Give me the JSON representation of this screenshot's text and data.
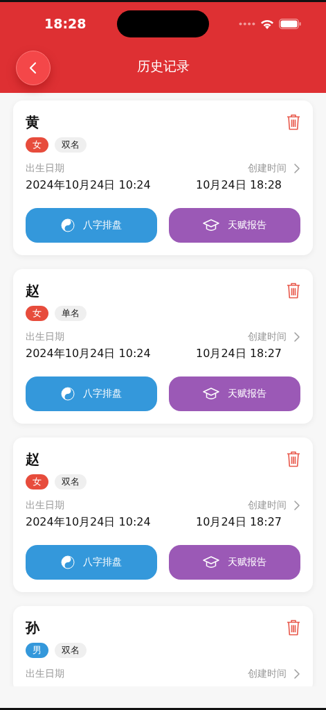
{
  "status_bar": {
    "time": "18:28"
  },
  "header": {
    "title": "历史记录"
  },
  "records": [
    {
      "name": "黄",
      "gender": {
        "label": "女",
        "color": "#e74c3c"
      },
      "name_type": "双名",
      "birth_label": "出生日期",
      "birth_value": "2024年10月24日 10:24",
      "created_label": "创建时间",
      "created_value": "10月24日 18:28",
      "buttons": [
        {
          "label": "八字排盘",
          "kind": "bazi"
        },
        {
          "label": "天赋报告",
          "kind": "talent"
        }
      ]
    },
    {
      "name": "赵",
      "gender": {
        "label": "女",
        "color": "#e74c3c"
      },
      "name_type": "单名",
      "birth_label": "出生日期",
      "birth_value": "2024年10月24日 10:24",
      "created_label": "创建时间",
      "created_value": "10月24日 18:27",
      "buttons": [
        {
          "label": "八字排盘",
          "kind": "bazi"
        },
        {
          "label": "天赋报告",
          "kind": "talent"
        }
      ]
    },
    {
      "name": "赵",
      "gender": {
        "label": "女",
        "color": "#e74c3c"
      },
      "name_type": "双名",
      "birth_label": "出生日期",
      "birth_value": "2024年10月24日 10:24",
      "created_label": "创建时间",
      "created_value": "10月24日 18:27",
      "buttons": [
        {
          "label": "八字排盘",
          "kind": "bazi"
        },
        {
          "label": "天赋报告",
          "kind": "talent"
        }
      ]
    },
    {
      "name": "孙",
      "gender": {
        "label": "男",
        "color": "#3498db"
      },
      "name_type": "双名",
      "birth_label": "出生日期",
      "created_label": "创建时间"
    }
  ]
}
